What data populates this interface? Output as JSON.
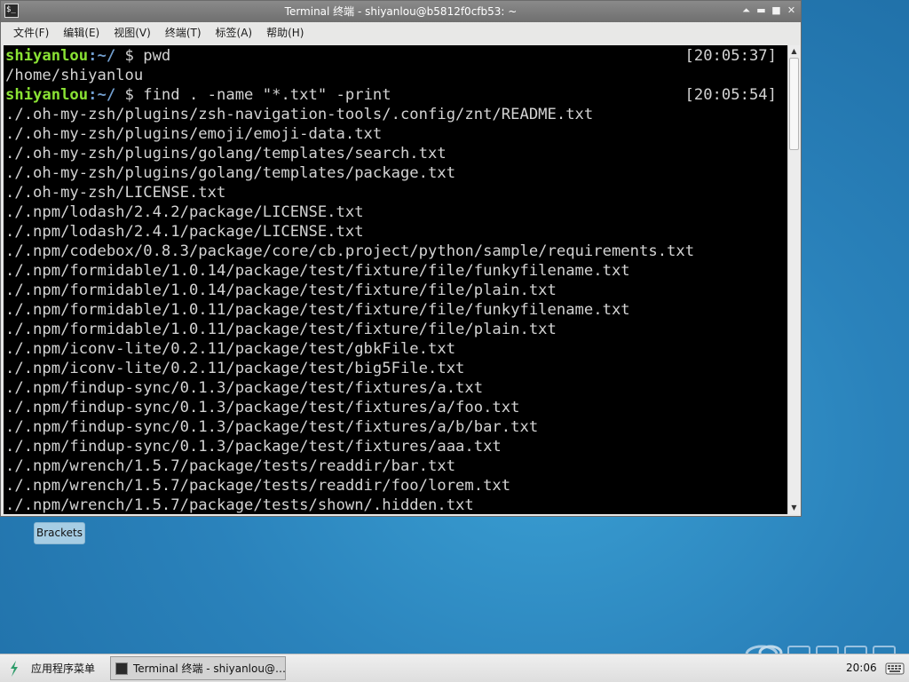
{
  "window": {
    "title": "Terminal 终端 - shiyanlou@b5812f0cfb53: ~",
    "icon": "terminal-icon",
    "controls": {
      "shade": "⏶",
      "minimize": "▬",
      "maximize": "■",
      "close": "✕"
    }
  },
  "menubar": {
    "items": [
      {
        "label": "文件(F)"
      },
      {
        "label": "编辑(E)"
      },
      {
        "label": "视图(V)"
      },
      {
        "label": "终端(T)"
      },
      {
        "label": "标签(A)"
      },
      {
        "label": "帮助(H)"
      }
    ]
  },
  "terminal": {
    "prompt_user": "shiyanlou",
    "prompt_path": ":~/",
    "prompt_symbol": " $ ",
    "commands": [
      {
        "cmd": "pwd",
        "time": "[20:05:37]"
      },
      {
        "cmd": "find . -name \"*.txt\" -print",
        "time": "[20:05:54]"
      }
    ],
    "pwd_output": "/home/shiyanlou",
    "find_output": [
      "./.oh-my-zsh/plugins/zsh-navigation-tools/.config/znt/README.txt",
      "./.oh-my-zsh/plugins/emoji/emoji-data.txt",
      "./.oh-my-zsh/plugins/golang/templates/search.txt",
      "./.oh-my-zsh/plugins/golang/templates/package.txt",
      "./.oh-my-zsh/LICENSE.txt",
      "./.npm/lodash/2.4.2/package/LICENSE.txt",
      "./.npm/lodash/2.4.1/package/LICENSE.txt",
      "./.npm/codebox/0.8.3/package/core/cb.project/python/sample/requirements.txt",
      "./.npm/formidable/1.0.14/package/test/fixture/file/funkyfilename.txt",
      "./.npm/formidable/1.0.14/package/test/fixture/file/plain.txt",
      "./.npm/formidable/1.0.11/package/test/fixture/file/funkyfilename.txt",
      "./.npm/formidable/1.0.11/package/test/fixture/file/plain.txt",
      "./.npm/iconv-lite/0.2.11/package/test/gbkFile.txt",
      "./.npm/iconv-lite/0.2.11/package/test/big5File.txt",
      "./.npm/findup-sync/0.1.3/package/test/fixtures/a.txt",
      "./.npm/findup-sync/0.1.3/package/test/fixtures/a/foo.txt",
      "./.npm/findup-sync/0.1.3/package/test/fixtures/a/b/bar.txt",
      "./.npm/findup-sync/0.1.3/package/test/fixtures/aaa.txt",
      "./.npm/wrench/1.5.7/package/tests/readdir/bar.txt",
      "./.npm/wrench/1.5.7/package/tests/readdir/foo/lorem.txt",
      "./.npm/wrench/1.5.7/package/tests/shown/.hidden.txt"
    ]
  },
  "scrollbar": {
    "up": "▲",
    "down": "▼"
  },
  "desktop": {
    "icon_label": "Brackets"
  },
  "taskbar": {
    "start_label": "应用程序菜单",
    "task_label": "Terminal 终端 - shiyanlou@…",
    "clock": "20:06"
  },
  "colors": {
    "prompt_user": "#8ae234",
    "prompt_path": "#729fcf",
    "terminal_bg": "#000000",
    "terminal_fg": "#d3d3d3"
  }
}
